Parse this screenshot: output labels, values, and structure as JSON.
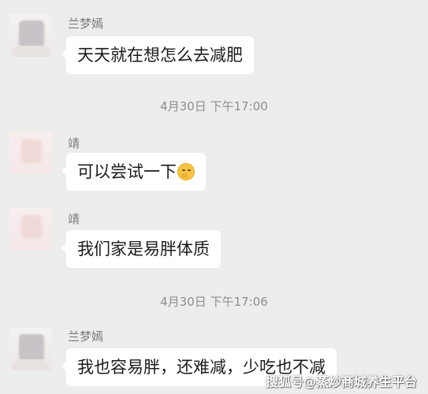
{
  "messages": [
    {
      "sender": "兰梦嫣",
      "text": "天天就在想怎么去减肥"
    },
    {
      "timestamp": "4月30日 下午17:00"
    },
    {
      "sender": "靖",
      "text": "可以尝试一下"
    },
    {
      "sender": "靖",
      "text": "我们家是易胖体质"
    },
    {
      "timestamp": "4月30日 下午17:06"
    },
    {
      "sender": "兰梦嫣",
      "text": "我也容易胖，还难减，少吃也不减"
    }
  ],
  "emoji": {
    "name": "thinking-face-icon"
  },
  "watermark": "搜狐号@蒸炒商城养生平台",
  "colors": {
    "background": "#ededed",
    "bubble": "#ffffff",
    "text": "#1b1b1b",
    "muted": "#7a7a7a"
  }
}
